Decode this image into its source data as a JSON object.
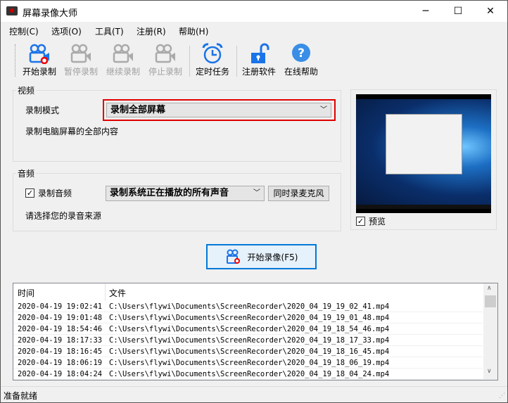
{
  "window": {
    "title": "屏幕录像大师",
    "minimize": "─",
    "maximize": "☐",
    "close": "✕"
  },
  "menu": [
    "控制(C)",
    "选项(O)",
    "工具(T)",
    "注册(R)",
    "帮助(H)"
  ],
  "toolbar": [
    {
      "label": "开始录制",
      "icon": "camera-record-icon",
      "enabled": true
    },
    {
      "label": "暂停录制",
      "icon": "camera-pause-icon",
      "enabled": false
    },
    {
      "label": "继续录制",
      "icon": "camera-resume-icon",
      "enabled": false
    },
    {
      "label": "停止录制",
      "icon": "camera-stop-icon",
      "enabled": false
    },
    {
      "label": "定时任务",
      "icon": "alarm-clock-icon",
      "enabled": true
    },
    {
      "label": "注册软件",
      "icon": "unlock-icon",
      "enabled": true
    },
    {
      "label": "在线帮助",
      "icon": "help-icon",
      "enabled": true
    }
  ],
  "video": {
    "group_label": "视频",
    "mode_label": "录制模式",
    "mode_value": "录制全部屏幕",
    "description": "录制电脑屏幕的全部内容",
    "highlight_color": "#e00000"
  },
  "audio": {
    "group_label": "音频",
    "record_audio_label": "录制音频",
    "record_audio_checked": true,
    "source_value": "录制系统正在播放的所有声音",
    "mic_button": "同时录麦克风",
    "hint": "请选择您的录音来源"
  },
  "preview": {
    "label": "预览",
    "checked": true
  },
  "start_button": "开始录像(F5)",
  "list": {
    "headers": [
      "时间",
      "文件"
    ],
    "rows": [
      [
        "2020-04-19 19:02:41",
        "C:\\Users\\flywi\\Documents\\ScreenRecorder\\2020_04_19_19_02_41.mp4"
      ],
      [
        "2020-04-19 19:01:48",
        "C:\\Users\\flywi\\Documents\\ScreenRecorder\\2020_04_19_19_01_48.mp4"
      ],
      [
        "2020-04-19 18:54:46",
        "C:\\Users\\flywi\\Documents\\ScreenRecorder\\2020_04_19_18_54_46.mp4"
      ],
      [
        "2020-04-19 18:17:33",
        "C:\\Users\\flywi\\Documents\\ScreenRecorder\\2020_04_19_18_17_33.mp4"
      ],
      [
        "2020-04-19 18:16:45",
        "C:\\Users\\flywi\\Documents\\ScreenRecorder\\2020_04_19_18_16_45.mp4"
      ],
      [
        "2020-04-19 18:06:19",
        "C:\\Users\\flywi\\Documents\\ScreenRecorder\\2020_04_19_18_06_19.mp4"
      ],
      [
        "2020-04-19 18:04:24",
        "C:\\Users\\flywi\\Documents\\ScreenRecorder\\2020_04_19_18_04_24.mp4"
      ]
    ]
  },
  "status": "准备就绪"
}
